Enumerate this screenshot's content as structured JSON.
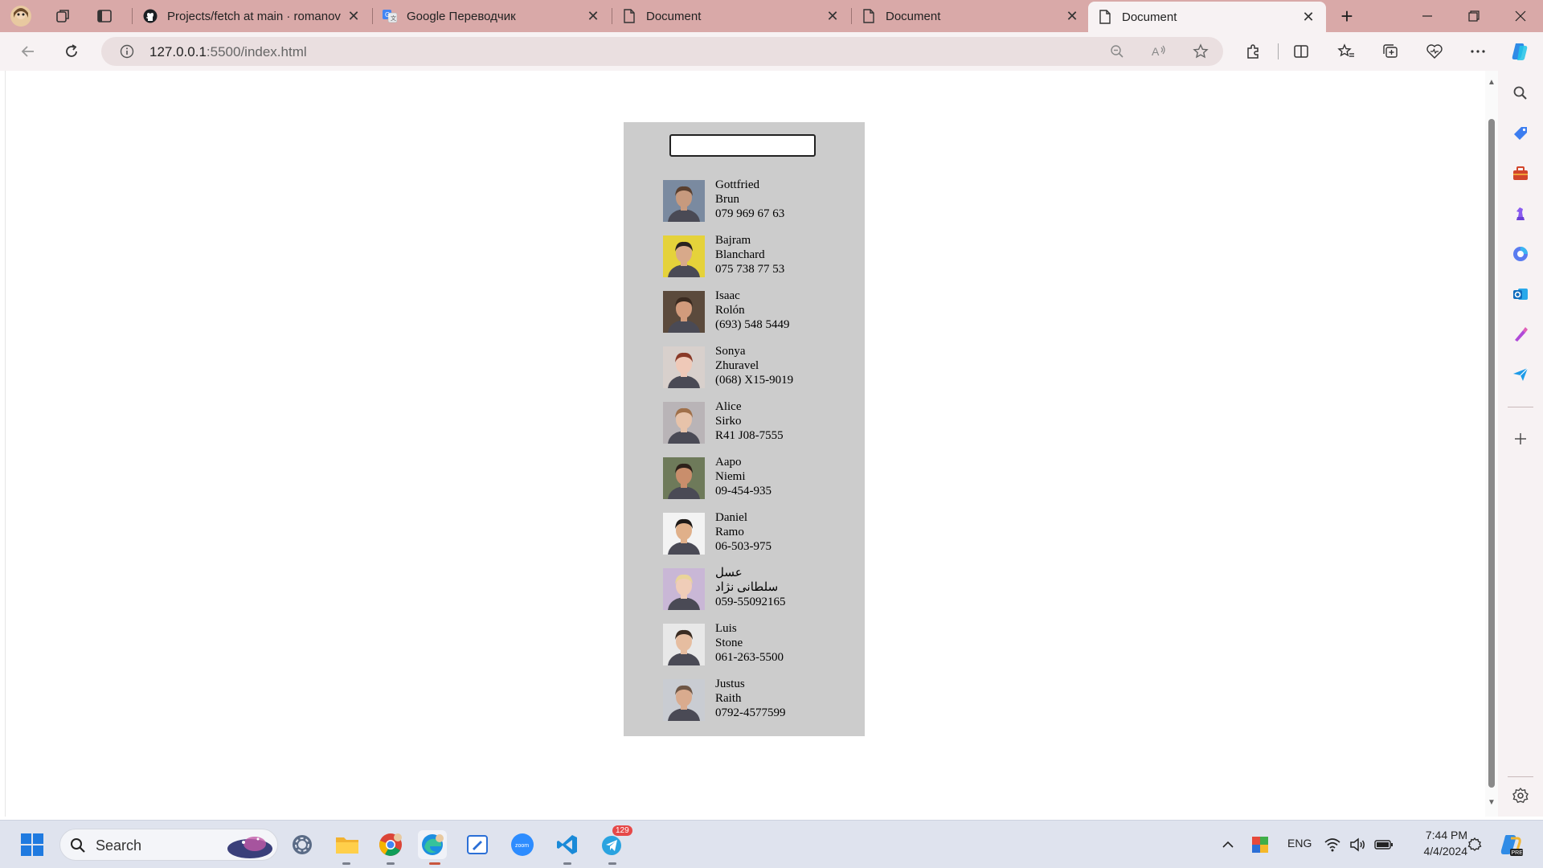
{
  "browser": {
    "tabs": [
      {
        "label": "Projects/fetch at main · romanov",
        "favicon": "github-icon",
        "active": false
      },
      {
        "label": "Google Переводчик",
        "favicon": "google-translate-icon",
        "active": false
      },
      {
        "label": "Document",
        "favicon": "document-icon",
        "active": false
      },
      {
        "label": "Document",
        "favicon": "document-icon",
        "active": false
      },
      {
        "label": "Document",
        "favicon": "document-icon",
        "active": true
      }
    ],
    "new_tab_glyph": "+",
    "url_host": "127.0.0.1",
    "url_rest": ":5500/index.html",
    "accent": "#d9a9a8"
  },
  "page": {
    "search": {
      "value": "",
      "placeholder": ""
    },
    "panel_color": "#cccccc",
    "contacts": [
      {
        "first": "Gottfried",
        "last": "Brun",
        "phone": "079 969 67 63",
        "avatar": "man-beard-plaid",
        "bg": "#7a8aa0",
        "skin": "#c79a7e",
        "hair": "#5a4030"
      },
      {
        "first": "Bajram",
        "last": "Blanchard",
        "phone": "075 738 77 53",
        "avatar": "man-yellow-bg",
        "bg": "#e5d23a",
        "skin": "#d8a98a",
        "hair": "#2a2320"
      },
      {
        "first": "Isaac",
        "last": "Rolón",
        "phone": "(693) 548 5449",
        "avatar": "man-orange-shirt",
        "bg": "#5b4a3c",
        "skin": "#d29b7c",
        "hair": "#3a2a20"
      },
      {
        "first": "Sonya",
        "last": "Zhuravel",
        "phone": "(068) X15-9019",
        "avatar": "woman-redhead",
        "bg": "#d8d0cc",
        "skin": "#efc9b8",
        "hair": "#8a3a28"
      },
      {
        "first": "Alice",
        "last": "Sirko",
        "phone": "R41 J08-7555",
        "avatar": "woman-curly",
        "bg": "#b9b4b7",
        "skin": "#e7c3aa",
        "hair": "#a0704a"
      },
      {
        "first": "Aapo",
        "last": "Niemi",
        "phone": "09-454-935",
        "avatar": "man-smiling",
        "bg": "#6e7a5a",
        "skin": "#c98e6c",
        "hair": "#2e211a"
      },
      {
        "first": "Daniel",
        "last": "Ramo",
        "phone": "06-503-975",
        "avatar": "man-white-bg",
        "bg": "#f3f3f3",
        "skin": "#e0b08a",
        "hair": "#1e1a18"
      },
      {
        "first": "عسل",
        "last": "سلطانی نژاد",
        "phone": "059-55092165",
        "avatar": "woman-blonde",
        "bg": "#c9b7d6",
        "skin": "#f0cdb8",
        "hair": "#e9d49a"
      },
      {
        "first": "Luis",
        "last": "Stone",
        "phone": "061-263-5500",
        "avatar": "man-light-bg",
        "bg": "#e8e8e8",
        "skin": "#e6bda0",
        "hair": "#3a2c22"
      },
      {
        "first": "Justus",
        "last": "Raith",
        "phone": "0792-4577599",
        "avatar": "man-bald",
        "bg": "#c9ccd2",
        "skin": "#d9ab8e",
        "hair": "#6e5646"
      }
    ]
  },
  "sidebar_icons": [
    "search-icon",
    "tag-icon",
    "briefcase-icon",
    "chess-icon",
    "copilot-icon",
    "outlook-icon",
    "designer-icon",
    "send-icon",
    "add-icon",
    "settings-icon"
  ],
  "taskbar": {
    "search_label": "Search",
    "telegram_badge": "129",
    "lang": "ENG",
    "time": "7:44 PM",
    "date": "4/4/2024"
  }
}
